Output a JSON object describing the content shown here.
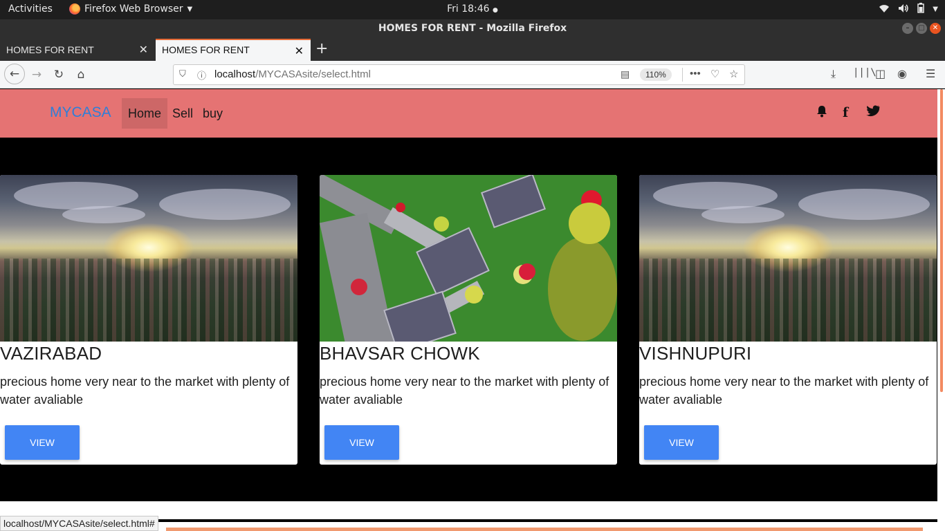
{
  "system": {
    "activities": "Activities",
    "app_name": "Firefox Web Browser",
    "clock": "Fri 18:46"
  },
  "window": {
    "title": "HOMES FOR RENT - Mozilla Firefox"
  },
  "tabs": [
    {
      "label": "HOMES FOR RENT",
      "active": false
    },
    {
      "label": "HOMES FOR RENT",
      "active": true
    }
  ],
  "urlbar": {
    "host": "localhost",
    "path": "/MYCASAsite/select.html",
    "zoom": "110%"
  },
  "site": {
    "brand": "MYCASA",
    "nav": [
      "Home",
      "Sell",
      "buy"
    ],
    "icons": [
      "bell-icon",
      "facebook-icon",
      "twitter-icon"
    ]
  },
  "cards": [
    {
      "title": "VAZIRABAD",
      "text": "precious home very near to the market with plenty of water avaliable",
      "button": "VIEW",
      "image": "sunset-city"
    },
    {
      "title": "BHAVSAR CHOWK",
      "text": "precious home very near to the market with plenty of water avaliable",
      "button": "VIEW",
      "image": "aerial-houses"
    },
    {
      "title": "VISHNUPURI",
      "text": "precious home very near to the market with plenty of water avaliable",
      "button": "VIEW",
      "image": "sunset-city"
    }
  ],
  "status": "localhost/MYCASAsite/select.html#",
  "colors": {
    "navbar_bg": "#e57373",
    "brand": "#2f7ed8",
    "button": "#4285f4",
    "tab_accent": "#e66b37"
  }
}
